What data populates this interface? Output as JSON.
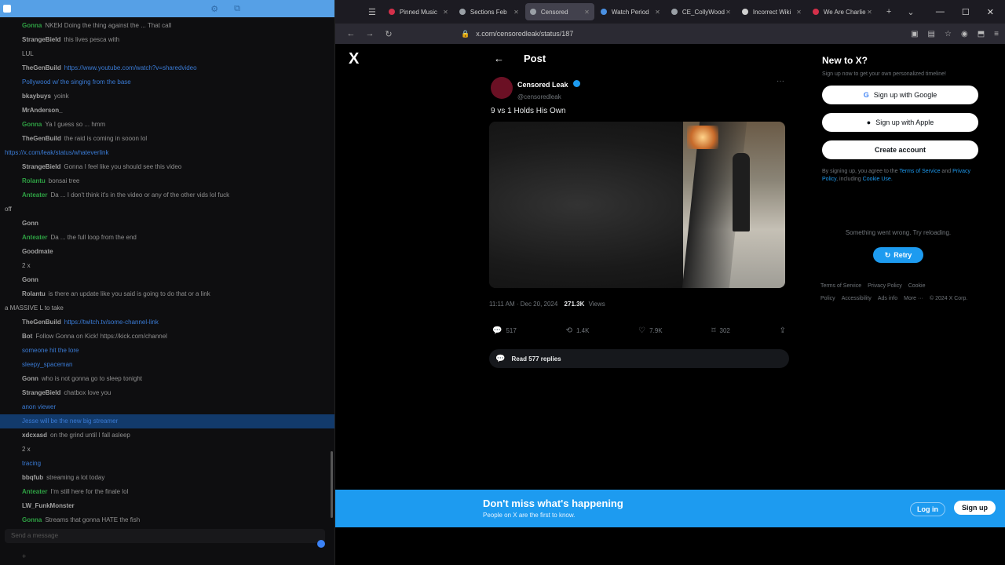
{
  "colors": {
    "accent": "#1d9bf0",
    "chat_bg": "#0e0e10",
    "highlight": "#123a6b"
  },
  "chat": {
    "titlebar": "",
    "messages": [
      {
        "user": "Gonna",
        "color": "#2ea043",
        "text": "NKEkl Doing the thing against the ... That call"
      },
      {
        "user": "StrangeBield",
        "color": "#a0a0a0",
        "text": "this lives pesca with"
      },
      {
        "user": "",
        "color": "#a0a0a0",
        "text": "LUL"
      },
      {
        "user": "TheGenBuild",
        "color": "#a0a0a0",
        "text": "https://www.youtube.com/watch?v=sharedvideo",
        "link": true
      },
      {
        "user": "",
        "color": "#3a7bd5",
        "text": "Pollywood  w/ the singing from the base"
      },
      {
        "user": "bkaybuys",
        "color": "#a0a0a0",
        "text": "yoink"
      },
      {
        "user": "MrAnderson_",
        "color": "#a0a0a0",
        "text": ""
      },
      {
        "user": "Gonna",
        "color": "#2ea043",
        "text": "Ya I guess so ... hmm"
      },
      {
        "user": "TheGenBuild",
        "color": "#a0a0a0",
        "text": "the raid is coming in sooon lol"
      },
      {
        "user": "",
        "color": "#3a7bd5",
        "text": "https://x.com/leak/status/whateverlink",
        "link": true,
        "wrap": true
      },
      {
        "user": "StrangeBield",
        "color": "#a0a0a0",
        "text": "Gonna  I feel like you should see this video"
      },
      {
        "user": "Rolantu",
        "color": "#2ea043",
        "text": "bonsai tree"
      },
      {
        "user": "Anteater",
        "color": "#2ea043",
        "text": "Da ... I don't think it's in the video or any of the other vids lol fuck"
      },
      {
        "user": "",
        "color": "#a0a0a0",
        "text": "off",
        "wrap": true
      },
      {
        "user": "Gonn",
        "color": "#a0a0a0",
        "text": ""
      },
      {
        "user": "Anteater",
        "color": "#2ea043",
        "text": "Da ... the full loop from the end"
      },
      {
        "user": "Goodmate",
        "color": "#a0a0a0",
        "text": ""
      },
      {
        "user": "",
        "color": "#a0a0a0",
        "text": "2 x"
      },
      {
        "user": "Gonn",
        "color": "#a0a0a0",
        "text": ""
      },
      {
        "user": "Rolantu",
        "color": "#a0a0a0",
        "text": "is there an update like you said is going to do that or a link"
      },
      {
        "user": "",
        "color": "#a0a0a0",
        "text": "a MASSIVE L to take",
        "wrap": true
      },
      {
        "user": "TheGenBuild",
        "color": "#a0a0a0",
        "text": "https://twitch.tv/some-channel-link",
        "link": true
      },
      {
        "user": "Bot",
        "color": "#a0a0a0",
        "text": "Follow Gonna on Kick!  https://kick.com/channel",
        "bot": true
      },
      {
        "user": "",
        "color": "#3a7bd5",
        "text": "someone hit the lore"
      },
      {
        "user": "",
        "color": "#3a7bd5",
        "text": "sleepy_spaceman"
      },
      {
        "user": "Gonn",
        "color": "#a0a0a0",
        "text": "who is not gonna go to sleep tonight"
      },
      {
        "user": "StrangeBield",
        "color": "#a0a0a0",
        "text": "chatbox   love you"
      },
      {
        "user": "",
        "color": "#3a7bd5",
        "text": "anon viewer"
      },
      {
        "user": "",
        "color": "#3a7bd5",
        "text": "Jesse will be the new big streamer",
        "hl": true
      },
      {
        "user": "xdcxasd",
        "color": "#a0a0a0",
        "text": "on the grind until I fall asleep"
      },
      {
        "user": "",
        "color": "#a0a0a0",
        "text": "2 x"
      },
      {
        "user": "",
        "color": "#3a7bd5",
        "text": "tracing"
      },
      {
        "user": "bbqfub",
        "color": "#a0a0a0",
        "text": "streaming a lot today"
      },
      {
        "user": "Anteater",
        "color": "#2ea043",
        "text": "I'm still here for the finale lol"
      },
      {
        "user": "LW_FunkMonster",
        "color": "#a0a0a0",
        "text": ""
      },
      {
        "user": "Gonna",
        "color": "#2ea043",
        "text": "Streams that gonna HATE the fish"
      }
    ],
    "input_placeholder": "Send a message",
    "bottom_label": "+"
  },
  "browser": {
    "tabs": [
      {
        "label": "Pinned Music",
        "fav": "#d4304a"
      },
      {
        "label": "Sections Feb",
        "fav": "#9aa0a6"
      },
      {
        "label": "Censored",
        "fav": "#9aa0a6",
        "active": true
      },
      {
        "label": "Watch Period",
        "fav": "#4a90e2"
      },
      {
        "label": "CE_CollyWood",
        "fav": "#9aa0a6"
      },
      {
        "label": "Incorrect Wiki",
        "fav": "#cfcfcf"
      },
      {
        "label": "We Are Charlie",
        "fav": "#d4304a"
      }
    ],
    "new_tab": "+",
    "list_all_tabs": "⌄",
    "url": "x.com/censoredleak/status/187"
  },
  "x": {
    "logo": "X",
    "header_title": "Post",
    "author_name": "Censored Leak",
    "author_handle": "@censoredleak",
    "post_text": "9 vs 1 Holds His Own",
    "meta_time": "11:11 AM · Dec 20, 2024",
    "views_num": "271.3K",
    "views_label": "Views",
    "actions": {
      "reply": "517",
      "repost": "1.4K",
      "like": "7.9K",
      "bookmark": "302"
    },
    "read_replies": "Read 577 replies",
    "sidebar": {
      "title": "New to X?",
      "subtitle": "Sign up now to get your own personalized timeline!",
      "google": "Sign up with Google",
      "apple": "Sign up with Apple",
      "create": "Create account",
      "terms_pre": "By signing up, you agree to the",
      "terms_link1": "Terms of Service",
      "terms_mid": "and",
      "terms_link2": "Privacy Policy",
      "terms_mid2": ", including",
      "terms_link3": "Cookie Use.",
      "error": "Something went wrong. Try reloading.",
      "retry": "Retry",
      "footer": [
        "Terms of Service",
        "Privacy Policy",
        "Cookie Policy",
        "Accessibility",
        "Ads info",
        "More ···",
        "© 2024 X Corp."
      ]
    },
    "banner": {
      "title": "Don't miss what's happening",
      "subtitle": "People on X are the first to know.",
      "login": "Log in",
      "signup": "Sign up"
    }
  }
}
